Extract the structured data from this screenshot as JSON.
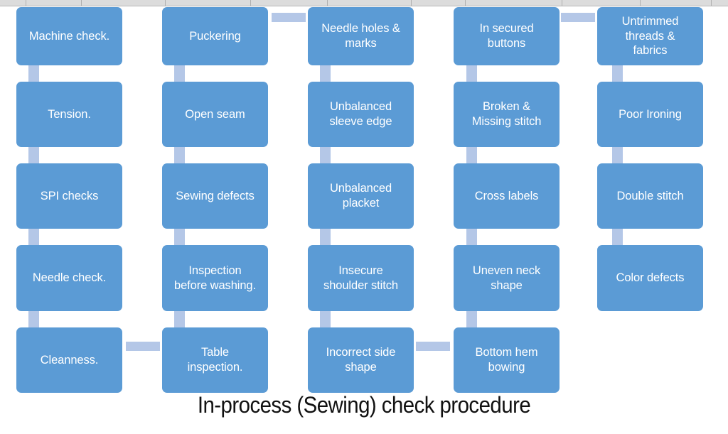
{
  "title": "In-process (Sewing) check procedure",
  "colors": {
    "node_fill": "#5B9BD5",
    "node_text": "#FFFFFF",
    "connector": "#B4C7E7",
    "title_text": "#111111",
    "background": "#FFFFFF",
    "sheet_header": "#DCDCDC"
  },
  "columns": [
    {
      "name": "column-1",
      "nodes": [
        "Machine check.",
        "Tension.",
        "SPI checks",
        "Needle check.",
        "Cleanness."
      ]
    },
    {
      "name": "column-2",
      "nodes": [
        "Puckering",
        "Open seam",
        "Sewing defects",
        "Inspection\nbefore washing.",
        "Table\ninspection."
      ]
    },
    {
      "name": "column-3",
      "nodes": [
        "Needle holes &\nmarks",
        "Unbalanced\nsleeve edge",
        "Unbalanced\nplacket",
        "Insecure\nshoulder stitch",
        "Incorrect side\nshape"
      ]
    },
    {
      "name": "column-4",
      "nodes": [
        "In secured\nbuttons",
        "Broken &\nMissing stitch",
        "Cross labels",
        "Uneven neck\nshape",
        "Bottom hem\nbowing"
      ]
    },
    {
      "name": "column-5",
      "nodes": [
        "Untrimmed\nthreads &\nfabrics",
        "Poor Ironing",
        "Double stitch",
        "Color defects"
      ]
    }
  ],
  "connectors": {
    "vertical_count": 19,
    "horizontal": [
      {
        "from": "column-2-row-1",
        "to": "column-3-row-1"
      },
      {
        "from": "column-4-row-1",
        "to": "column-5-row-1"
      },
      {
        "from": "column-1-row-5",
        "to": "column-2-row-5"
      },
      {
        "from": "column-3-row-5",
        "to": "column-4-row-5"
      }
    ]
  }
}
